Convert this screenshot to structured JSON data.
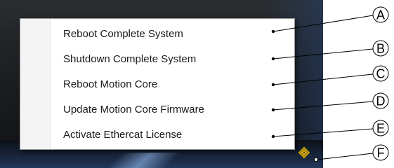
{
  "context_menu": {
    "items": [
      {
        "label": "Reboot Complete System",
        "callout": "A"
      },
      {
        "label": "Shutdown Complete System",
        "callout": "B"
      },
      {
        "label": "Reboot Motion Core",
        "callout": "C"
      },
      {
        "label": "Update Motion Core Firmware",
        "callout": "D"
      },
      {
        "label": "Activate Ethercat License",
        "callout": "E"
      }
    ]
  },
  "tray": {
    "icon": "warning-diamond-icon",
    "icon_color": "#e8c21a",
    "callout": "F"
  },
  "colors": {
    "desktop": "#1c1e21",
    "taskbar": "#1b2a44",
    "menu_background": "#ffffff",
    "menu_text": "#1a1a1a"
  }
}
